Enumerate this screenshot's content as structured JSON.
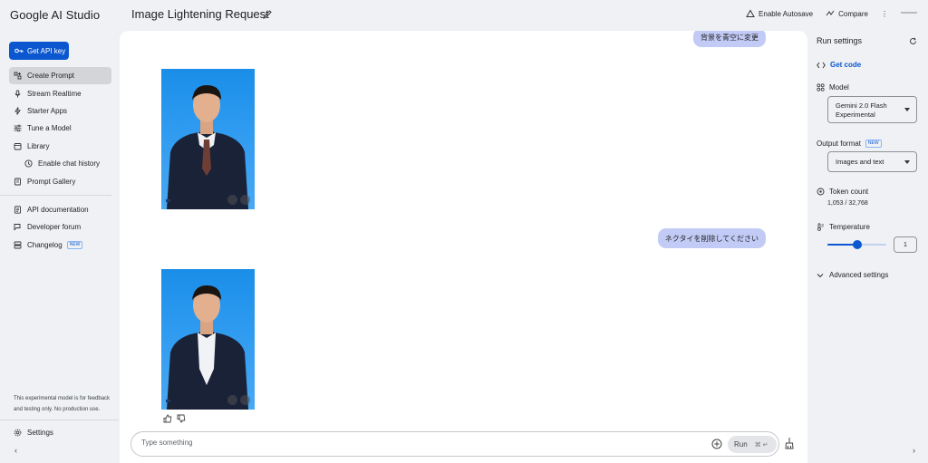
{
  "app": {
    "title": "Google AI Studio"
  },
  "header": {
    "prompt_title": "Image Lightening Request",
    "autosave_label": "Enable Autosave",
    "compare_label": "Compare",
    "more_label": "⋮"
  },
  "sidebar": {
    "api_key_label": "Get API key",
    "items": [
      {
        "label": "Create Prompt",
        "icon": "create-prompt-icon",
        "active": true
      },
      {
        "label": "Stream Realtime",
        "icon": "microphone-icon"
      },
      {
        "label": "Starter Apps",
        "icon": "bolt-icon"
      },
      {
        "label": "Tune a Model",
        "icon": "tune-icon"
      },
      {
        "label": "Library",
        "icon": "library-icon"
      },
      {
        "label": "Enable chat history",
        "icon": "history-icon"
      },
      {
        "label": "Prompt Gallery",
        "icon": "gallery-icon"
      },
      {
        "label": "API documentation",
        "icon": "docs-icon"
      },
      {
        "label": "Developer forum",
        "icon": "forum-icon"
      },
      {
        "label": "Changelog",
        "icon": "changelog-icon",
        "badge": "NEW"
      }
    ],
    "disclaimer": "This experimental model is for feedback and testing only. No production use.",
    "settings_label": "Settings",
    "collapse_glyph": "‹"
  },
  "chat": {
    "messages": [
      {
        "role": "user",
        "text": "背景を青空に変更"
      },
      {
        "role": "user",
        "text": "ネクタイを削除してください"
      }
    ],
    "composer": {
      "placeholder": "Type something",
      "run_label": "Run",
      "run_shortcut": "⌘ ↵"
    }
  },
  "run_settings": {
    "title": "Run settings",
    "get_code_label": "Get code",
    "model_label": "Model",
    "model_value": "Gemini 2.0 Flash Experimental",
    "output_format_label": "Output format",
    "output_format_badge": "NEW",
    "output_format_value": "Images and text",
    "token_count_label": "Token count",
    "token_count_value": "1,053 / 32,768",
    "temperature_label": "Temperature",
    "temperature_value": "1",
    "temperature_max": 2,
    "advanced_label": "Advanced settings",
    "collapse_glyph": "›"
  },
  "colors": {
    "accent": "#0b57d0",
    "user_bubble": "#c2cbf6",
    "photo_bg": "#2d9af0"
  }
}
